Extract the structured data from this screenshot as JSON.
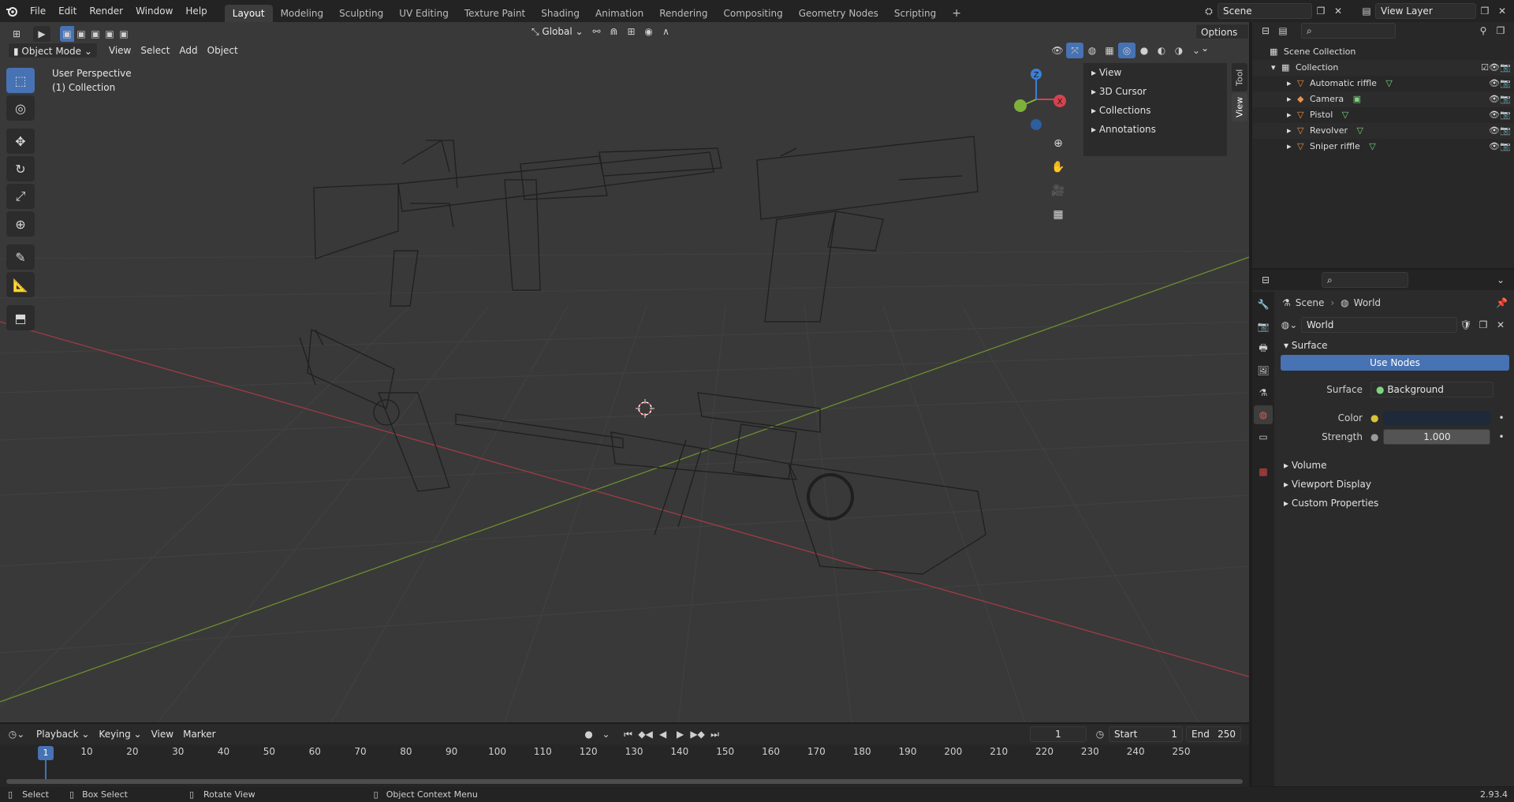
{
  "topbar": {
    "menus": [
      "File",
      "Edit",
      "Render",
      "Window",
      "Help"
    ],
    "workspaces": [
      "Layout",
      "Modeling",
      "Sculpting",
      "UV Editing",
      "Texture Paint",
      "Shading",
      "Animation",
      "Rendering",
      "Compositing",
      "Geometry Nodes",
      "Scripting"
    ],
    "active_workspace": "Layout",
    "add_tab": "+",
    "scene": "Scene",
    "view_layer": "View Layer"
  },
  "viewport": {
    "mode": "Object Mode",
    "menus": [
      "View",
      "Select",
      "Add",
      "Object"
    ],
    "orientation": "Global",
    "options": "Options",
    "perspective": "User Perspective",
    "collection": "(1) Collection",
    "npanel_items": [
      "View",
      "3D Cursor",
      "Collections",
      "Annotations"
    ],
    "npanel_tabs": [
      "Tool",
      "View"
    ],
    "axes": {
      "x": "X",
      "y": "Y",
      "z": "Z"
    }
  },
  "outliner": {
    "root": "Scene Collection",
    "collection": "Collection",
    "objects": [
      "Automatic riffle",
      "Camera",
      "Pistol",
      "Revolver",
      "Sniper riffle"
    ]
  },
  "properties": {
    "breadcrumb_scene": "Scene",
    "breadcrumb_world": "World",
    "world_name": "World",
    "surface_section": "Surface",
    "use_nodes": "Use Nodes",
    "surface_label": "Surface",
    "surface_value": "Background",
    "color_label": "Color",
    "strength_label": "Strength",
    "strength_value": "1.000",
    "sections": [
      "Volume",
      "Viewport Display",
      "Custom Properties"
    ]
  },
  "timeline": {
    "menus": [
      "Playback",
      "Keying",
      "View",
      "Marker"
    ],
    "current_frame": "1",
    "start_label": "Start",
    "start": "1",
    "end_label": "End",
    "end": "250",
    "ticks": [
      "1",
      "10",
      "20",
      "30",
      "40",
      "50",
      "60",
      "70",
      "80",
      "90",
      "100",
      "110",
      "120",
      "130",
      "140",
      "150",
      "160",
      "170",
      "180",
      "190",
      "200",
      "210",
      "220",
      "230",
      "240",
      "250"
    ]
  },
  "status": {
    "select": "Select",
    "box_select": "Box Select",
    "rotate_view": "Rotate View",
    "context_menu": "Object Context Menu",
    "version": "2.93.4"
  },
  "colors": {
    "accent": "#4772b3",
    "world_color": "#1e2a3a",
    "x_axis": "#d6424f",
    "y_axis": "#7fb13a",
    "z_axis": "#3b80d9"
  }
}
